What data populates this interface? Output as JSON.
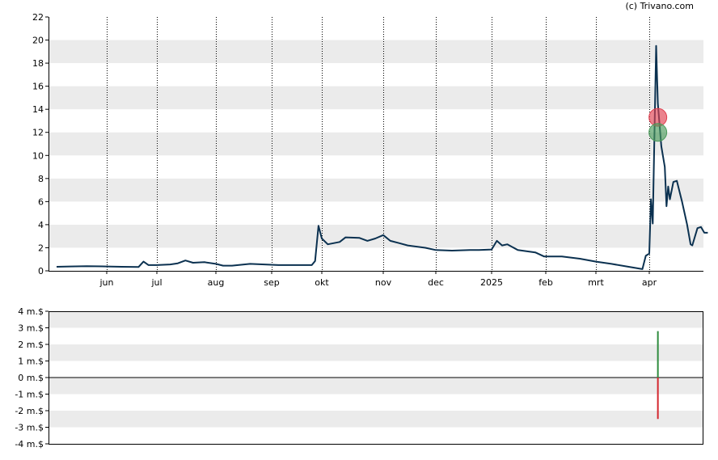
{
  "credit": "(c) Trivano.com",
  "colors": {
    "band": "#ebebeb",
    "line": "#0b3150",
    "marker_sell": "#e04050",
    "marker_buy": "#4a9a5a",
    "bar_pos": "#2e8b3e",
    "bar_neg": "#d4262e"
  },
  "chart_data": [
    {
      "type": "line",
      "ylim": [
        0,
        22
      ],
      "yticks": [
        "0",
        "2",
        "4",
        "6",
        "8",
        "10",
        "12",
        "14",
        "16",
        "18",
        "20",
        "22"
      ],
      "grid": true,
      "xticks": [
        {
          "label": "jun",
          "date": "2024-06-01"
        },
        {
          "label": "jul",
          "date": "2024-07-01"
        },
        {
          "label": "aug",
          "date": "2024-08-01"
        },
        {
          "label": "sep",
          "date": "2024-09-01"
        },
        {
          "label": "okt",
          "date": "2024-10-01"
        },
        {
          "label": "nov",
          "date": "2024-11-01"
        },
        {
          "label": "dec",
          "date": "2024-12-01"
        },
        {
          "label": "2025",
          "date": "2025-01-01"
        },
        {
          "label": "feb",
          "date": "2025-02-01"
        },
        {
          "label": "mrt",
          "date": "2025-03-01"
        },
        {
          "label": "apr",
          "date": "2025-04-01"
        }
      ],
      "series": [
        {
          "points": [
            [
              "2024-05-02",
              0.35
            ],
            [
              "2024-05-10",
              0.38
            ],
            [
              "2024-05-20",
              0.4
            ],
            [
              "2024-06-01",
              0.38
            ],
            [
              "2024-06-10",
              0.35
            ],
            [
              "2024-06-20",
              0.33
            ],
            [
              "2024-06-23",
              0.8
            ],
            [
              "2024-06-26",
              0.5
            ],
            [
              "2024-07-01",
              0.5
            ],
            [
              "2024-07-08",
              0.55
            ],
            [
              "2024-07-12",
              0.65
            ],
            [
              "2024-07-16",
              0.9
            ],
            [
              "2024-07-20",
              0.7
            ],
            [
              "2024-07-26",
              0.75
            ],
            [
              "2024-08-01",
              0.6
            ],
            [
              "2024-08-05",
              0.45
            ],
            [
              "2024-08-10",
              0.45
            ],
            [
              "2024-08-20",
              0.6
            ],
            [
              "2024-08-28",
              0.55
            ],
            [
              "2024-09-05",
              0.5
            ],
            [
              "2024-09-15",
              0.5
            ],
            [
              "2024-09-25",
              0.5
            ],
            [
              "2024-09-27",
              0.85
            ],
            [
              "2024-09-29",
              3.9
            ],
            [
              "2024-10-01",
              2.8
            ],
            [
              "2024-10-04",
              2.3
            ],
            [
              "2024-10-10",
              2.5
            ],
            [
              "2024-10-13",
              2.9
            ],
            [
              "2024-10-20",
              2.85
            ],
            [
              "2024-10-24",
              2.6
            ],
            [
              "2024-10-28",
              2.8
            ],
            [
              "2024-11-01",
              3.1
            ],
            [
              "2024-11-05",
              2.6
            ],
            [
              "2024-11-10",
              2.4
            ],
            [
              "2024-11-15",
              2.2
            ],
            [
              "2024-11-25",
              2.0
            ],
            [
              "2024-12-01",
              1.8
            ],
            [
              "2024-12-10",
              1.75
            ],
            [
              "2024-12-20",
              1.8
            ],
            [
              "2024-12-25",
              1.8
            ],
            [
              "2025-01-01",
              1.85
            ],
            [
              "2025-01-04",
              2.6
            ],
            [
              "2025-01-07",
              2.2
            ],
            [
              "2025-01-10",
              2.3
            ],
            [
              "2025-01-16",
              1.8
            ],
            [
              "2025-01-26",
              1.6
            ],
            [
              "2025-01-31",
              1.25
            ],
            [
              "2025-02-10",
              1.25
            ],
            [
              "2025-02-20",
              1.05
            ],
            [
              "2025-03-01",
              0.8
            ],
            [
              "2025-03-10",
              0.6
            ],
            [
              "2025-03-20",
              0.35
            ],
            [
              "2025-03-28",
              0.15
            ],
            [
              "2025-03-30",
              1.3
            ],
            [
              "2025-04-01",
              1.5
            ],
            [
              "2025-04-02",
              6.2
            ],
            [
              "2025-04-03",
              4.1
            ],
            [
              "2025-04-05",
              19.5
            ],
            [
              "2025-04-06",
              14.5
            ],
            [
              "2025-04-08",
              10.8
            ],
            [
              "2025-04-10",
              9.0
            ],
            [
              "2025-04-11",
              5.6
            ],
            [
              "2025-04-12",
              7.3
            ],
            [
              "2025-04-13",
              6.2
            ],
            [
              "2025-04-15",
              7.7
            ],
            [
              "2025-04-17",
              7.8
            ],
            [
              "2025-04-20",
              6.0
            ],
            [
              "2025-04-23",
              4.0
            ],
            [
              "2025-04-25",
              2.3
            ],
            [
              "2025-04-26",
              2.2
            ],
            [
              "2025-04-29",
              3.7
            ],
            [
              "2025-05-01",
              3.8
            ],
            [
              "2025-05-03",
              3.3
            ],
            [
              "2025-05-05",
              3.3
            ]
          ]
        }
      ],
      "markers": [
        {
          "date": "2025-04-06",
          "value": 13.3,
          "kind": "sell"
        },
        {
          "date": "2025-04-06",
          "value": 12.0,
          "kind": "buy"
        }
      ]
    },
    {
      "type": "bar",
      "ylim": [
        -4,
        4
      ],
      "yticks": [
        "-4 m.$",
        "-3 m.$",
        "-2 m.$",
        "-1 m.$",
        "0 m.$",
        "1 m.$",
        "2 m.$",
        "3 m.$",
        "4 m.$"
      ],
      "bars": [
        {
          "date": "2025-04-06",
          "value": 2.8
        },
        {
          "date": "2025-04-06",
          "value": -2.5
        }
      ]
    }
  ]
}
